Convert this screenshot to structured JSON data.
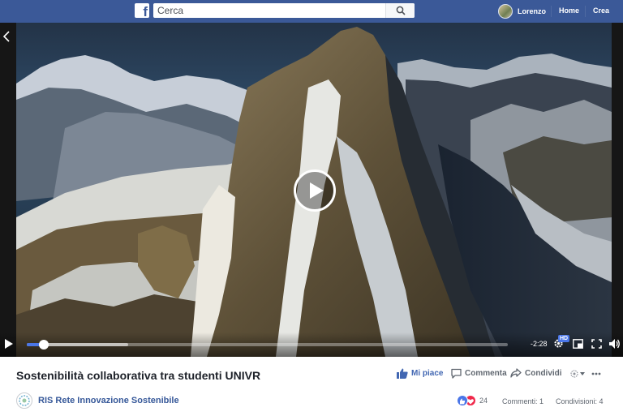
{
  "topbar": {
    "logo": "f",
    "search_placeholder": "Cerca",
    "profile_name": "Lorenzo",
    "nav_home": "Home",
    "nav_create": "Crea",
    "bar_color": "#3b5998"
  },
  "video": {
    "time_remaining": "-2:28",
    "quality_badge": "HD",
    "progress": 0.035,
    "buffered": 0.21
  },
  "post": {
    "title": "Sostenibilità collaborativa tra studenti UNIVR",
    "actions": {
      "like": "Mi piace",
      "comment": "Commenta",
      "share": "Condividi"
    },
    "page_name": "RIS Rete Innovazione Sostenibile",
    "reactions_count": "24",
    "comments": "Commenti: 1",
    "shares": "Condivisioni: 4"
  },
  "colors": {
    "accent": "#4267b2",
    "progress": "#4a76e8",
    "love": "#f0284a"
  },
  "icons": [
    "facebook-logo-icon",
    "search-icon",
    "chevron-left-icon",
    "play-icon",
    "gear-icon",
    "pip-icon",
    "fullscreen-icon",
    "volume-icon",
    "thumb-up-icon",
    "comment-icon",
    "share-icon",
    "reactions-icon",
    "more-icon"
  ]
}
